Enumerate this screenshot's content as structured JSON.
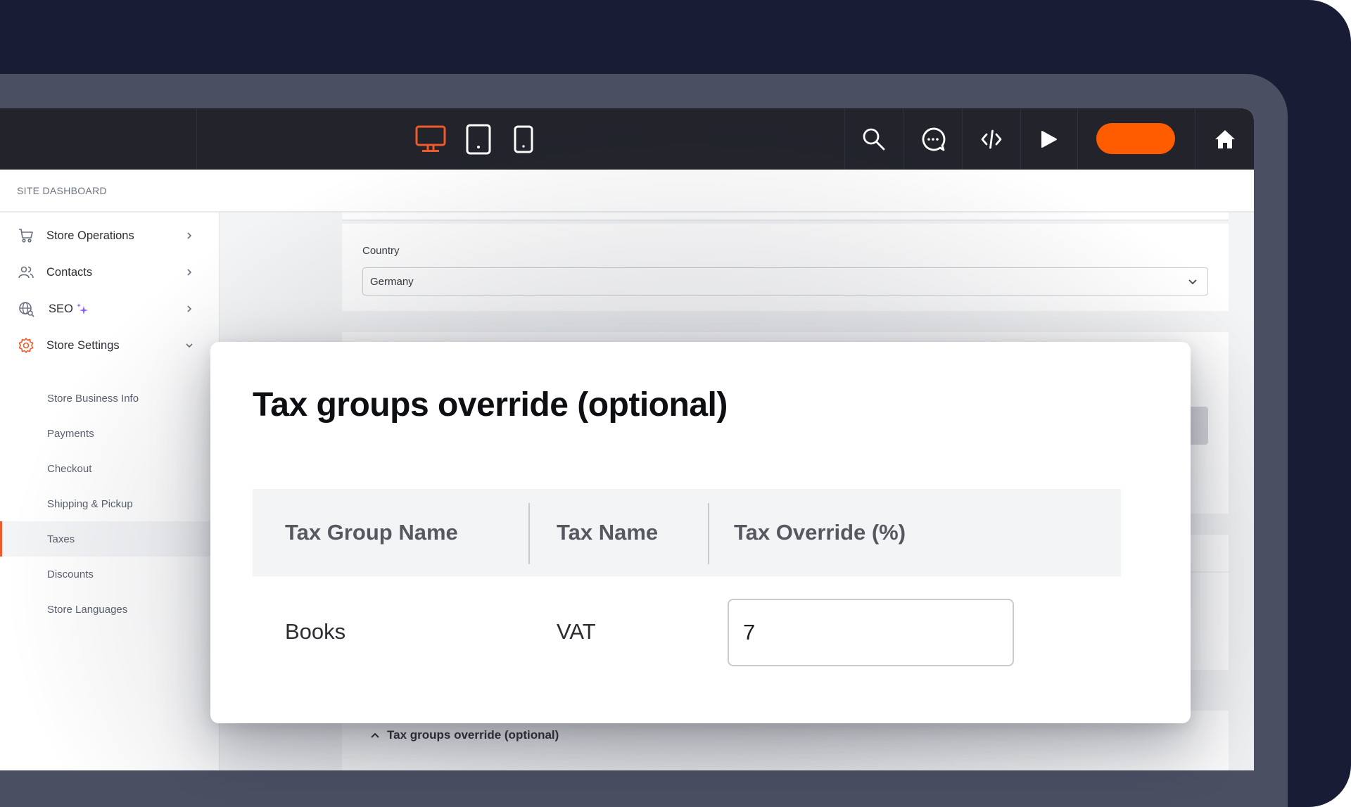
{
  "toolbar": {
    "devices": [
      {
        "name": "desktop",
        "icon": "desktop-icon",
        "active": true
      },
      {
        "name": "tablet",
        "icon": "tablet-icon",
        "active": false
      },
      {
        "name": "mobile",
        "icon": "mobile-icon",
        "active": false
      }
    ],
    "actions": [
      {
        "name": "search",
        "icon": "search-icon"
      },
      {
        "name": "comments",
        "icon": "chat-bubble-icon"
      },
      {
        "name": "code",
        "icon": "code-icon"
      },
      {
        "name": "preview",
        "icon": "play-icon"
      },
      {
        "name": "publish",
        "icon": ""
      },
      {
        "name": "home",
        "icon": "home-icon"
      }
    ],
    "accent_color": "#ff5c00"
  },
  "breadcrumb": {
    "label": "SITE DASHBOARD"
  },
  "sidebar": {
    "items": [
      {
        "label": "Store Operations",
        "icon": "cart-icon",
        "expanded": false
      },
      {
        "label": "Contacts",
        "icon": "users-icon",
        "expanded": false
      },
      {
        "label": "SEO",
        "icon": "globe-search-icon",
        "badge_icon": "sparkle-icon",
        "expanded": false
      },
      {
        "label": "Store Settings",
        "icon": "gear-icon",
        "expanded": true
      }
    ],
    "sub_items": [
      {
        "label": "Store Business Info",
        "active": false
      },
      {
        "label": "Payments",
        "active": false
      },
      {
        "label": "Checkout",
        "active": false
      },
      {
        "label": "Shipping & Pickup",
        "active": false
      },
      {
        "label": "Taxes",
        "active": true
      },
      {
        "label": "Discounts",
        "active": false
      },
      {
        "label": "Store Languages",
        "active": false
      }
    ]
  },
  "main": {
    "country": {
      "label": "Country",
      "value": "Germany"
    },
    "accordion_label": "Tax groups override (optional)"
  },
  "modal": {
    "title": "Tax groups override (optional)",
    "columns": [
      "Tax Group Name",
      "Tax Name",
      "Tax Override (%)"
    ],
    "rows": [
      {
        "tax_group_name": "Books",
        "tax_name": "VAT",
        "tax_override": "7"
      }
    ]
  }
}
